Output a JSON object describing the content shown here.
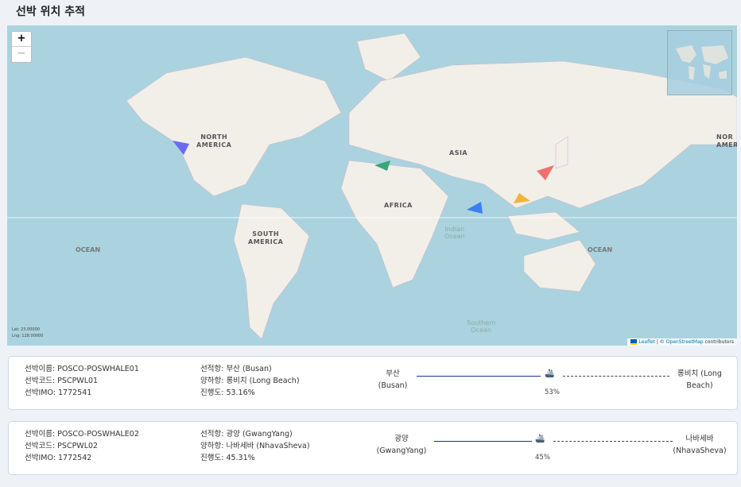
{
  "page": {
    "title": "선박 위치 추적"
  },
  "map": {
    "zoom_in": "+",
    "zoom_out": "−",
    "continents": [
      "NORTH\nAMERICA",
      "SOUTH\nAMERICA",
      "AFRICA",
      "ASIA",
      "NOR\nAMER"
    ],
    "oceans": [
      "OCEAN",
      "OCEAN",
      "Indian\nOcean",
      "Southern\nOcean"
    ],
    "coords": {
      "lat": "Lat: 23.00000",
      "lng": "Lng: 128.00000"
    },
    "attribution": {
      "leaflet": "Leaflet",
      "sep": " | © ",
      "osm": "OpenStreetMap",
      "suffix": " contributors"
    },
    "ship_markers": [
      {
        "color": "#6a6af5"
      },
      {
        "color": "#3aa876"
      },
      {
        "color": "#f07070"
      },
      {
        "color": "#f0b43a"
      },
      {
        "color": "#3a7ff5"
      }
    ]
  },
  "ships": [
    {
      "name": "선박이름: POSCO-POSWHALE01",
      "code": "선박코드: PSCPWL01",
      "imo": "선박IMO: 1772541",
      "load": "선적항: 부산 (Busan)",
      "unload": "양하항: 롱비치 (Long Beach)",
      "progress_text": "진행도: 53.16%",
      "from": "부산\n(Busan)",
      "to": "롱비치 (Long\nBeach)",
      "pct_label": "53%",
      "progress": 0.53
    },
    {
      "name": "선박이름: POSCO-POSWHALE02",
      "code": "선박코드: PSCPWL02",
      "imo": "선박IMO: 1772542",
      "load": "선적항: 광양 (GwangYang)",
      "unload": "양하항: 나바세바 (NhavaSheva)",
      "progress_text": "진행도: 45.31%",
      "from": "광양\n(GwangYang)",
      "to": "나바세바\n(NhavaSheva)",
      "pct_label": "45%",
      "progress": 0.45
    }
  ]
}
